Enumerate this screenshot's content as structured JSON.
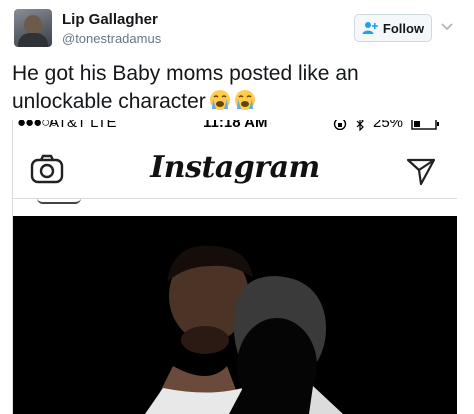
{
  "tweet": {
    "user_name": "Lip Gallagher",
    "user_handle": "@tonestradamus",
    "follow_label": "Follow",
    "text_line1": "He got his Baby moms posted like an",
    "text_line2": "unlockable character",
    "emoji": [
      "crying-face-emoji",
      "crying-face-emoji"
    ]
  },
  "screenshot": {
    "status": {
      "signal": "●●●○○",
      "carrier": "AT&T  LTE",
      "time": "11:18 AM",
      "battery_pct": "25%"
    },
    "app_title": "Instagram",
    "icons": [
      "camera-icon",
      "direct-send-icon"
    ]
  },
  "colors": {
    "text": "#14171a",
    "muted": "#657786",
    "follow_icon": "#1da1f2",
    "photo_bg": "#000000"
  }
}
